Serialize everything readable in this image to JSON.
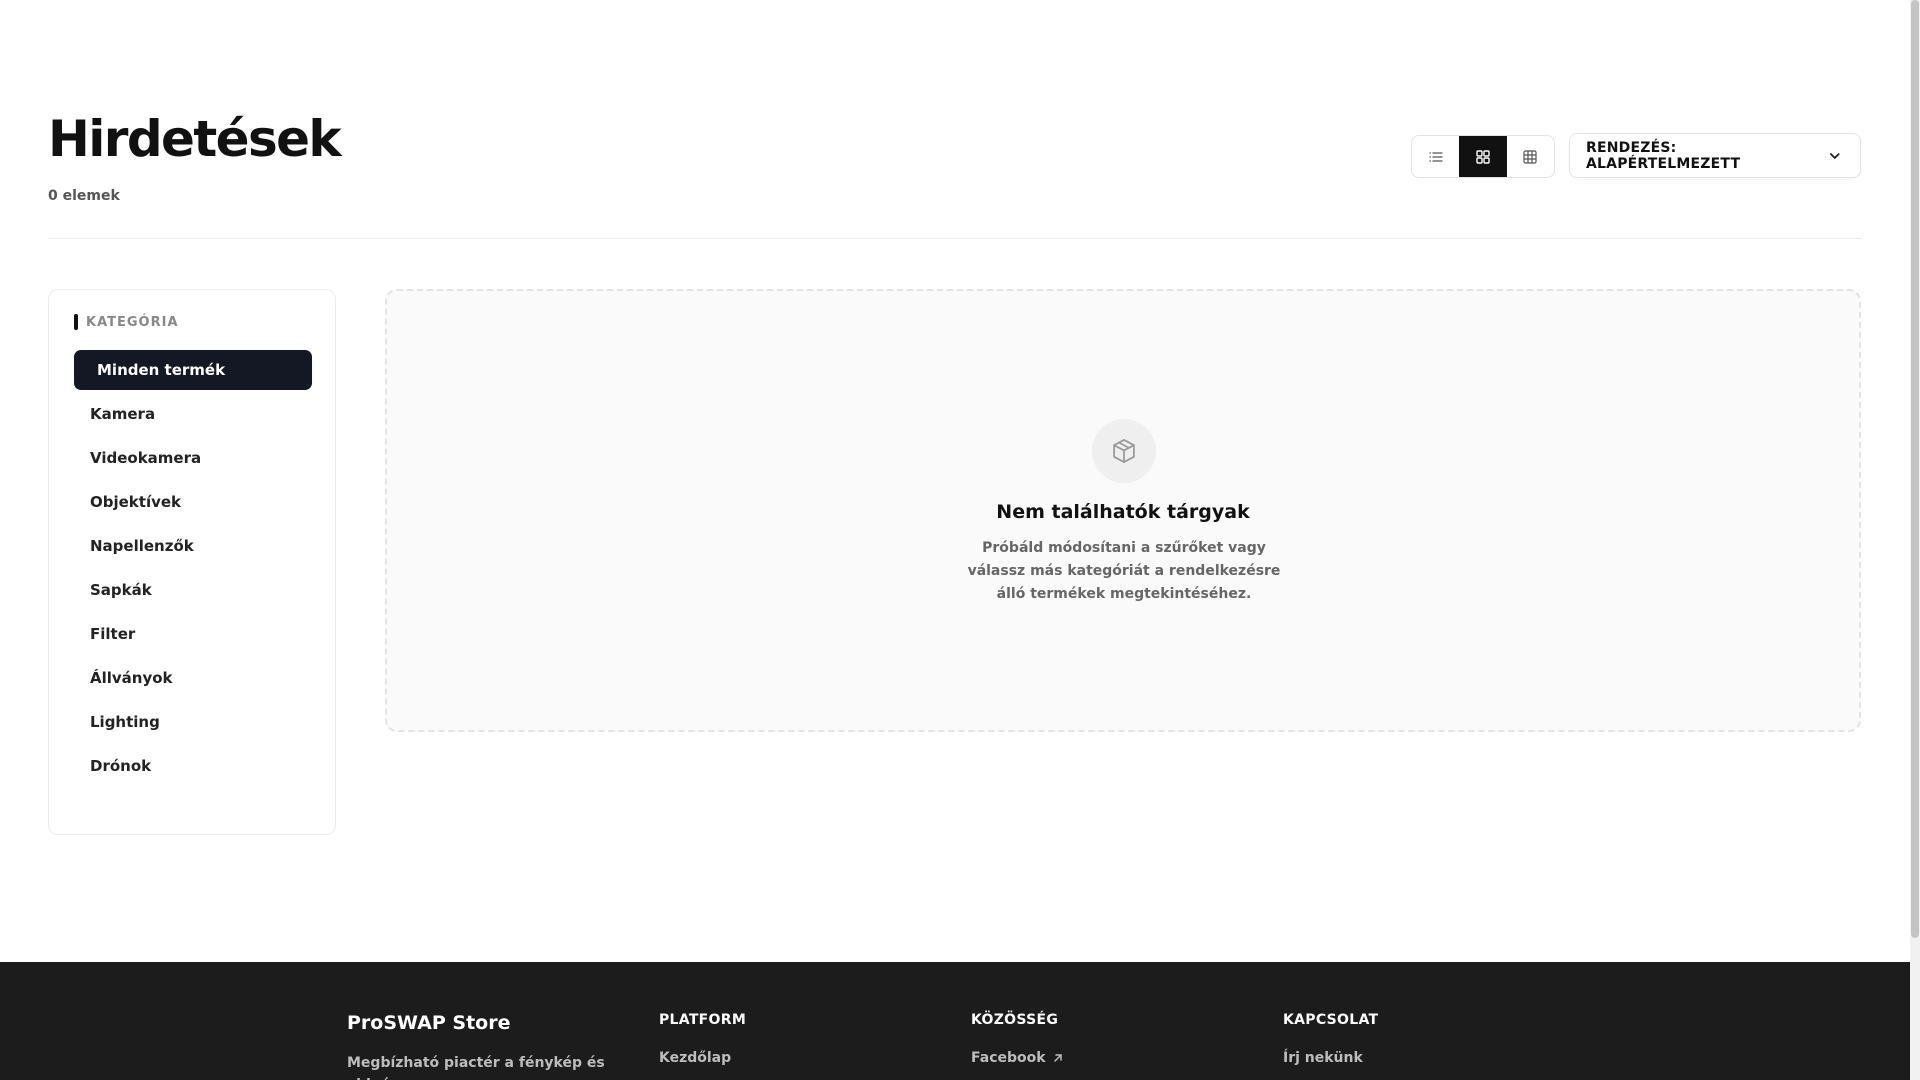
{
  "header": {
    "title": "Hirdetések",
    "item_count": "0 elemek",
    "sort_label": "RENDEZÉS: ALAPÉRTELMEZETT",
    "view_modes": [
      {
        "icon": "list-icon",
        "active": false
      },
      {
        "icon": "grid-large-icon",
        "active": true
      },
      {
        "icon": "grid-small-icon",
        "active": false
      }
    ]
  },
  "sidebar": {
    "heading": "KATEGÓRIA",
    "items": [
      {
        "label": "Minden termék",
        "active": true
      },
      {
        "label": "Kamera",
        "active": false
      },
      {
        "label": "Videokamera",
        "active": false
      },
      {
        "label": "Objektívek",
        "active": false
      },
      {
        "label": "Napellenzők",
        "active": false
      },
      {
        "label": "Sapkák",
        "active": false
      },
      {
        "label": "Filter",
        "active": false
      },
      {
        "label": "Állványok",
        "active": false
      },
      {
        "label": "Lighting",
        "active": false
      },
      {
        "label": "Drónok",
        "active": false
      }
    ]
  },
  "empty_state": {
    "icon": "box-icon",
    "title": "Nem találhatók tárgyak",
    "description": "Próbáld módosítani a szűrőket vagy válassz más kategóriát a rendelkezésre álló termékek megtekintéséhez."
  },
  "footer": {
    "brand": "ProSWAP Store",
    "brand_desc": "Megbízható piactér a fénykép és videó",
    "columns": [
      {
        "heading": "PLATFORM",
        "links": [
          {
            "label": "Kezdőlap",
            "external": false
          }
        ]
      },
      {
        "heading": "KÖZÖSSÉG",
        "links": [
          {
            "label": "Facebook",
            "external": true
          }
        ]
      },
      {
        "heading": "KAPCSOLAT",
        "links": [
          {
            "label": "Írj nekünk",
            "external": false
          }
        ]
      }
    ]
  },
  "colors": {
    "accent_dark": "#141824",
    "footer_bg": "#1c1c1c"
  }
}
